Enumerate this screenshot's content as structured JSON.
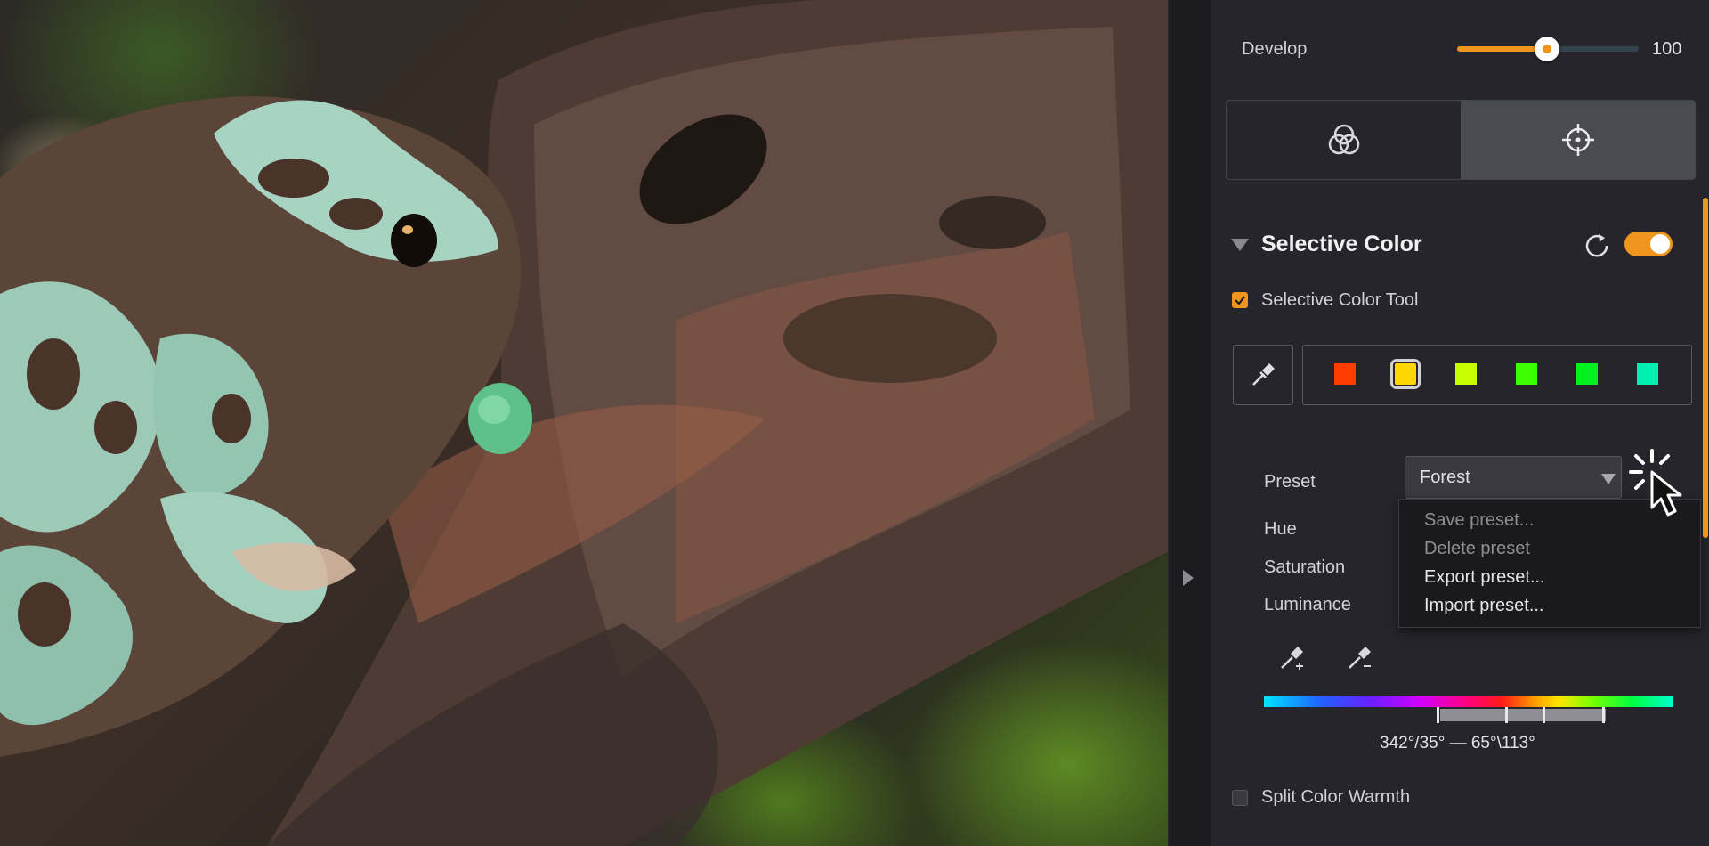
{
  "develop": {
    "label": "Develop",
    "value": "100",
    "level": 0.5
  },
  "view_switch": {
    "left_icon": "color-circles-icon",
    "right_icon": "crosshair-icon",
    "active": "right"
  },
  "section": {
    "title": "Selective Color",
    "enabled": true,
    "tool_checkbox_label": "Selective Color Tool",
    "tool_checked": true
  },
  "swatches": [
    "#ff3b00",
    "#ffd600",
    "#c8ff00",
    "#3cff00",
    "#00f020",
    "#00f0b0"
  ],
  "selected_swatch": 1,
  "preset": {
    "label": "Preset",
    "value": "Forest",
    "menu": [
      {
        "label": "Save preset...",
        "enabled": false
      },
      {
        "label": "Delete preset",
        "enabled": false
      },
      {
        "label": "Export preset...",
        "enabled": true
      },
      {
        "label": "Import preset...",
        "enabled": true
      }
    ]
  },
  "adjustments": {
    "hue": "Hue",
    "saturation": "Saturation",
    "luminance": "Luminance"
  },
  "range_readout": "342°/35° — 65°\\113°",
  "split_warmth": {
    "label": "Split Color Warmth",
    "checked": false
  },
  "colors": {
    "accent": "#f0951d",
    "panel": "#25252b"
  }
}
